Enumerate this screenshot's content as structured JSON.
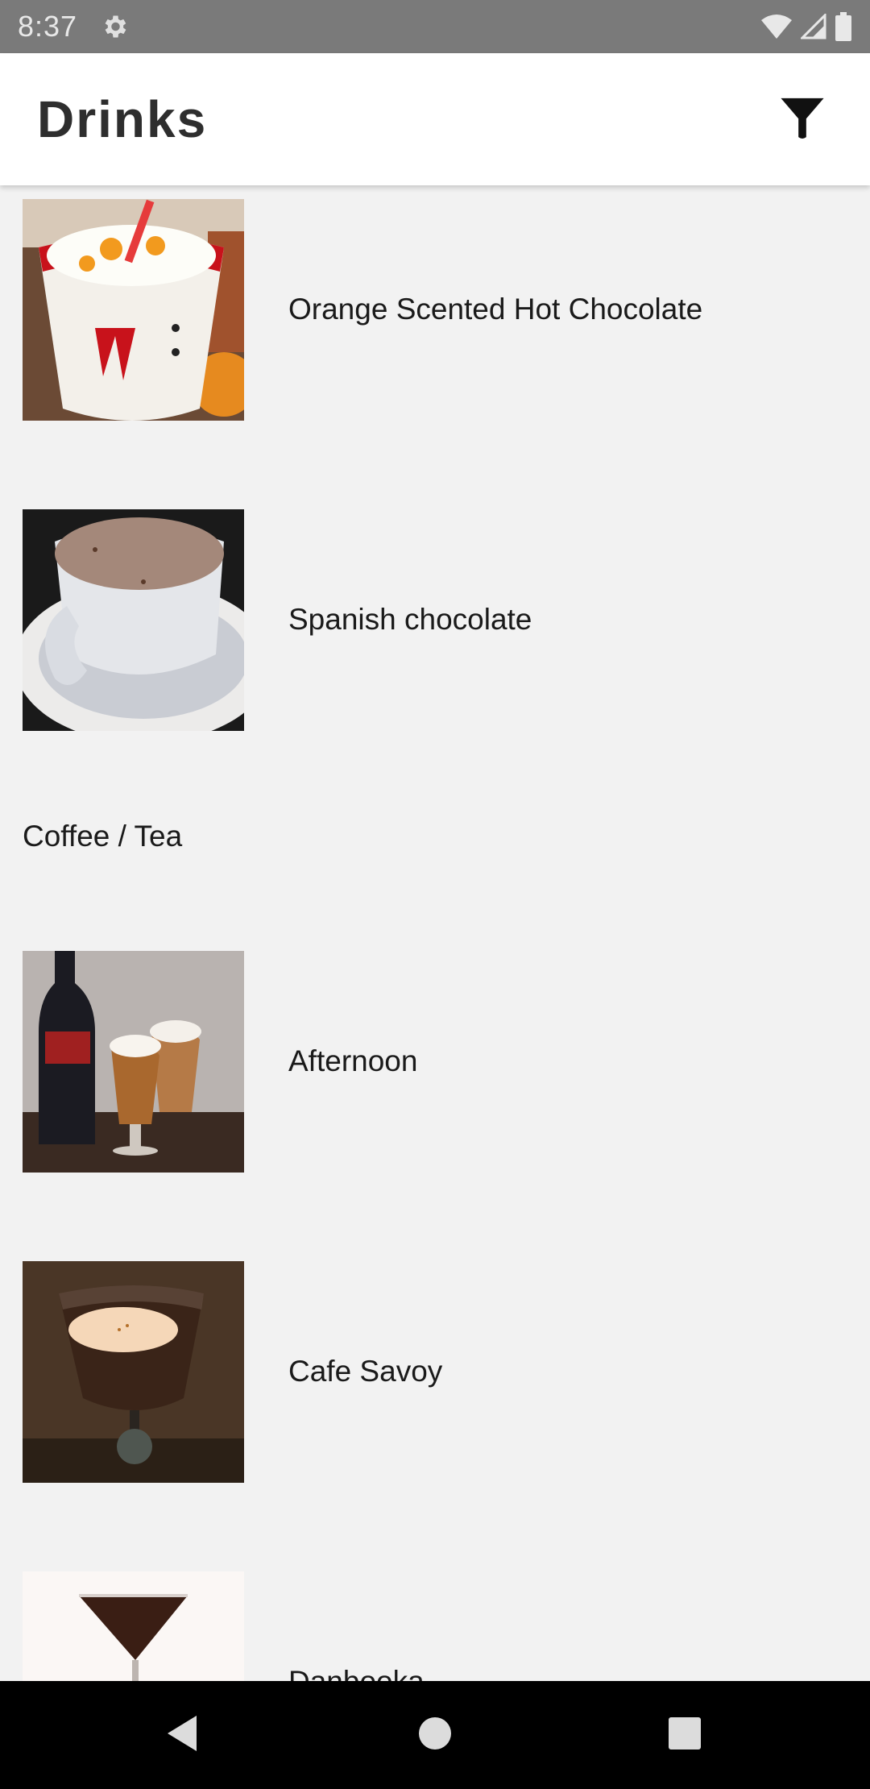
{
  "status_bar": {
    "time": "8:37",
    "icons": [
      "settings-icon",
      "wifi-icon",
      "cell-signal-icon",
      "battery-icon"
    ]
  },
  "app_bar": {
    "title": "Drinks",
    "filter_icon": "filter-icon"
  },
  "list": {
    "items": [
      {
        "type": "drink",
        "name": "Orange Scented Hot Chocolate",
        "thumb": "hot-chocolate-mug"
      },
      {
        "type": "drink",
        "name": "Spanish chocolate",
        "thumb": "cocoa-cup-saucer"
      },
      {
        "type": "header",
        "name": "Coffee / Tea"
      },
      {
        "type": "drink",
        "name": "Afternoon",
        "thumb": "baileys-coffee-glasses"
      },
      {
        "type": "drink",
        "name": "Cafe Savoy",
        "thumb": "layered-coffee-glass"
      },
      {
        "type": "drink",
        "name": "Danbooka",
        "thumb": "martini-glass"
      }
    ]
  },
  "nav_bar": {
    "buttons": [
      "back-icon",
      "home-icon",
      "recents-icon"
    ]
  },
  "colors": {
    "status_bar": "#7a7a7a",
    "app_bar": "#ffffff",
    "background": "#f2f2f2",
    "nav_bar": "#000000"
  }
}
